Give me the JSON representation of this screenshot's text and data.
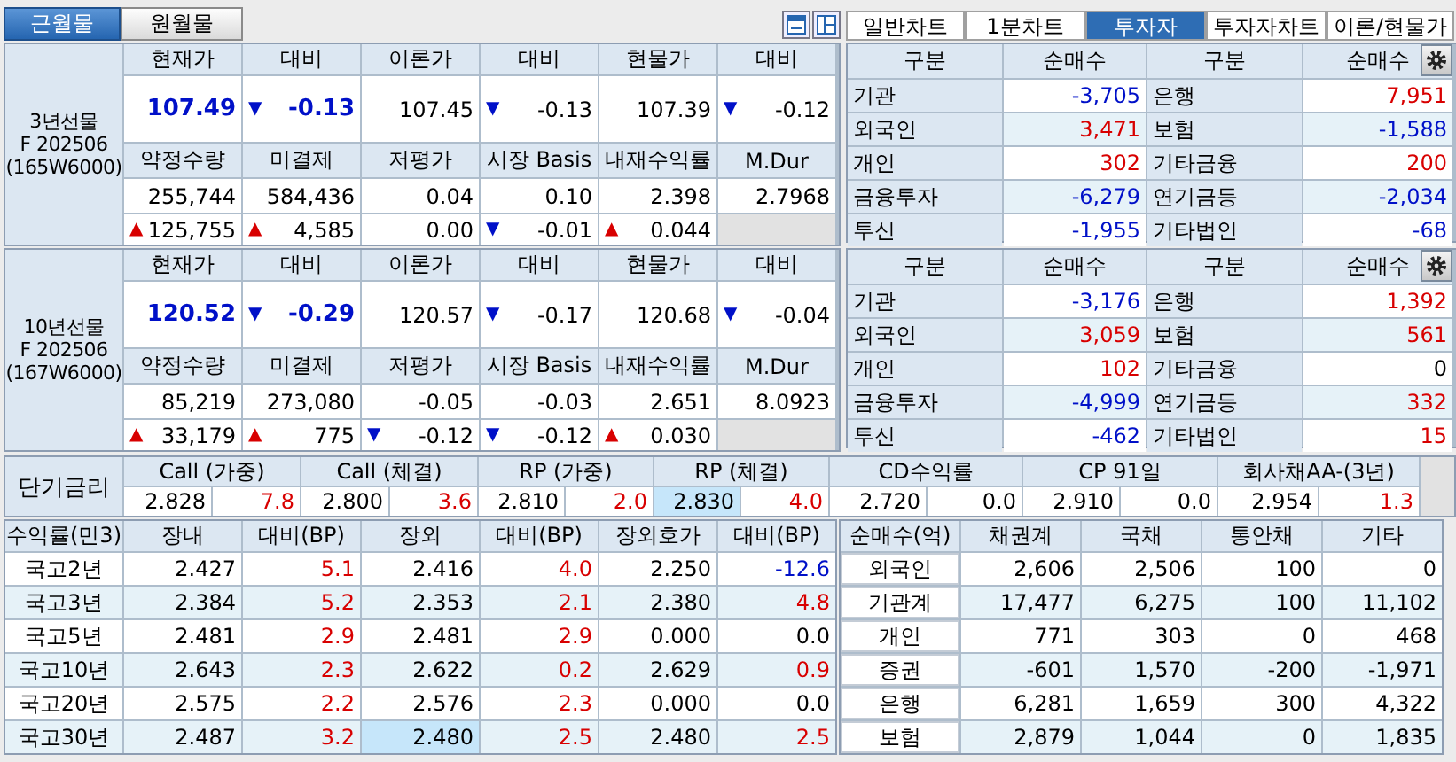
{
  "month_tabs": [
    {
      "label": "근월물",
      "selected": true
    },
    {
      "label": "원월물",
      "selected": false
    }
  ],
  "view_tabs": [
    {
      "label": "일반차트",
      "selected": false
    },
    {
      "label": "1분차트",
      "selected": false
    },
    {
      "label": "투자자",
      "selected": true
    },
    {
      "label": "투자자차트",
      "selected": false
    },
    {
      "label": "이론/현물가",
      "selected": false
    }
  ],
  "futures": [
    {
      "name": "3년선물",
      "contract": "F 202506",
      "code": "(165W6000)",
      "price_headers": [
        "현재가",
        "대비",
        "이론가",
        "대비",
        "현물가",
        "대비"
      ],
      "price_row": [
        {
          "value": "107.49",
          "emphasis": true
        },
        {
          "arrow": "▼",
          "rising": false,
          "value": "-0.13",
          "emphasis": true
        },
        {
          "value": "107.45",
          "emphasis": false
        },
        {
          "arrow": "▼",
          "rising": false,
          "value": "-0.13",
          "emphasis": false
        },
        {
          "value": "107.39",
          "emphasis": false
        },
        {
          "arrow": "▼",
          "rising": false,
          "value": "-0.12",
          "emphasis": false
        }
      ],
      "stat_headers": [
        "약정수량",
        "미결제",
        "저평가",
        "시장 Basis",
        "내재수익률",
        "M.Dur"
      ],
      "stat_row": [
        "255,744",
        "584,436",
        "0.04",
        "0.10",
        "2.398",
        "2.7968"
      ],
      "stat_change_row": [
        {
          "arrow": "▲",
          "rising": true,
          "value": "125,755"
        },
        {
          "arrow": "▲",
          "rising": true,
          "value": "4,585"
        },
        {
          "value": "0.00"
        },
        {
          "arrow": "▼",
          "rising": false,
          "value": "-0.01"
        },
        {
          "arrow": "▲",
          "rising": true,
          "value": "0.044"
        }
      ]
    },
    {
      "name": "10년선물",
      "contract": "F 202506",
      "code": "(167W6000)",
      "price_headers": [
        "현재가",
        "대비",
        "이론가",
        "대비",
        "현물가",
        "대비"
      ],
      "price_row": [
        {
          "value": "120.52",
          "emphasis": true
        },
        {
          "arrow": "▼",
          "rising": false,
          "value": "-0.29",
          "emphasis": true
        },
        {
          "value": "120.57",
          "emphasis": false
        },
        {
          "arrow": "▼",
          "rising": false,
          "value": "-0.17",
          "emphasis": false
        },
        {
          "value": "120.68",
          "emphasis": false
        },
        {
          "arrow": "▼",
          "rising": false,
          "value": "-0.04",
          "emphasis": false
        }
      ],
      "stat_headers": [
        "약정수량",
        "미결제",
        "저평가",
        "시장 Basis",
        "내재수익률",
        "M.Dur"
      ],
      "stat_row": [
        "85,219",
        "273,080",
        "-0.05",
        "-0.03",
        "2.651",
        "8.0923"
      ],
      "stat_change_row": [
        {
          "arrow": "▲",
          "rising": true,
          "value": "33,179"
        },
        {
          "arrow": "▲",
          "rising": true,
          "value": "775"
        },
        {
          "arrow": "▼",
          "rising": false,
          "value": "-0.12"
        },
        {
          "arrow": "▼",
          "rising": false,
          "value": "-0.12"
        },
        {
          "arrow": "▲",
          "rising": true,
          "value": "0.030"
        }
      ]
    }
  ],
  "investors": [
    {
      "headers": [
        "구분",
        "순매수",
        "구분",
        "순매수"
      ],
      "left": [
        {
          "name": "기관",
          "value": "-3,705",
          "rising": false,
          "falling": true
        },
        {
          "name": "외국인",
          "value": "3,471",
          "rising": true,
          "falling": false
        },
        {
          "name": "개인",
          "value": "302",
          "rising": true,
          "falling": false
        },
        {
          "name": "금융투자",
          "value": "-6,279",
          "rising": false,
          "falling": true
        },
        {
          "name": "투신",
          "value": "-1,955",
          "rising": false,
          "falling": true
        }
      ],
      "right": [
        {
          "name": "은행",
          "value": "7,951",
          "rising": true,
          "falling": false
        },
        {
          "name": "보험",
          "value": "-1,588",
          "rising": false,
          "falling": true
        },
        {
          "name": "기타금융",
          "value": "200",
          "rising": true,
          "falling": false
        },
        {
          "name": "연기금등",
          "value": "-2,034",
          "rising": false,
          "falling": true
        },
        {
          "name": "기타법인",
          "value": "-68",
          "rising": false,
          "falling": true
        }
      ]
    },
    {
      "headers": [
        "구분",
        "순매수",
        "구분",
        "순매수"
      ],
      "left": [
        {
          "name": "기관",
          "value": "-3,176",
          "rising": false,
          "falling": true
        },
        {
          "name": "외국인",
          "value": "3,059",
          "rising": true,
          "falling": false
        },
        {
          "name": "개인",
          "value": "102",
          "rising": true,
          "falling": false
        },
        {
          "name": "금융투자",
          "value": "-4,999",
          "rising": false,
          "falling": true
        },
        {
          "name": "투신",
          "value": "-462",
          "rising": false,
          "falling": true
        }
      ],
      "right": [
        {
          "name": "은행",
          "value": "1,392",
          "rising": true,
          "falling": false
        },
        {
          "name": "보험",
          "value": "561",
          "rising": true,
          "falling": false
        },
        {
          "name": "기타금융",
          "value": "0",
          "rising": false,
          "falling": false
        },
        {
          "name": "연기금등",
          "value": "332",
          "rising": true,
          "falling": false
        },
        {
          "name": "기타법인",
          "value": "15",
          "rising": true,
          "falling": false
        }
      ]
    }
  ],
  "short_rates": {
    "title": "단기금리",
    "items": [
      {
        "label": "Call (가중)",
        "rate": "2.828",
        "change": "7.8",
        "rising": true,
        "highlighted": false
      },
      {
        "label": "Call (체결)",
        "rate": "2.800",
        "change": "3.6",
        "rising": true,
        "highlighted": false
      },
      {
        "label": "RP (가중)",
        "rate": "2.810",
        "change": "2.0",
        "rising": true,
        "highlighted": false
      },
      {
        "label": "RP (체결)",
        "rate": "2.830",
        "change": "4.0",
        "rising": true,
        "highlighted": true
      },
      {
        "label": "CD수익률",
        "rate": "2.720",
        "change": "0.0",
        "rising": false,
        "highlighted": false
      },
      {
        "label": "CP 91일",
        "rate": "2.910",
        "change": "0.0",
        "rising": false,
        "highlighted": false
      },
      {
        "label": "회사채AA-(3년)",
        "rate": "2.954",
        "change": "1.3",
        "rising": true,
        "highlighted": false
      }
    ]
  },
  "yields": {
    "headers": [
      "수익률(민3)",
      "장내",
      "대비(BP)",
      "장외",
      "대비(BP)",
      "장외호가",
      "대비(BP)"
    ],
    "rows": [
      {
        "name": "국고2년",
        "cells": [
          {
            "value": "2.427",
            "rising": false,
            "falling": false,
            "highlighted": false
          },
          {
            "value": "5.1",
            "rising": true,
            "falling": false,
            "highlighted": false
          },
          {
            "value": "2.416",
            "rising": false,
            "falling": false,
            "highlighted": false
          },
          {
            "value": "4.0",
            "rising": true,
            "falling": false,
            "highlighted": false
          },
          {
            "value": "2.250",
            "rising": false,
            "falling": false,
            "highlighted": false
          },
          {
            "value": "-12.6",
            "rising": false,
            "falling": true,
            "highlighted": false
          }
        ]
      },
      {
        "name": "국고3년",
        "cells": [
          {
            "value": "2.384",
            "rising": false,
            "falling": false,
            "highlighted": false
          },
          {
            "value": "5.2",
            "rising": true,
            "falling": false,
            "highlighted": false
          },
          {
            "value": "2.353",
            "rising": false,
            "falling": false,
            "highlighted": false
          },
          {
            "value": "2.1",
            "rising": true,
            "falling": false,
            "highlighted": false
          },
          {
            "value": "2.380",
            "rising": false,
            "falling": false,
            "highlighted": false
          },
          {
            "value": "4.8",
            "rising": true,
            "falling": false,
            "highlighted": false
          }
        ]
      },
      {
        "name": "국고5년",
        "cells": [
          {
            "value": "2.481",
            "rising": false,
            "falling": false,
            "highlighted": false
          },
          {
            "value": "2.9",
            "rising": true,
            "falling": false,
            "highlighted": false
          },
          {
            "value": "2.481",
            "rising": false,
            "falling": false,
            "highlighted": false
          },
          {
            "value": "2.9",
            "rising": true,
            "falling": false,
            "highlighted": false
          },
          {
            "value": "0.000",
            "rising": false,
            "falling": false,
            "highlighted": false
          },
          {
            "value": "0.0",
            "rising": false,
            "falling": false,
            "highlighted": false
          }
        ]
      },
      {
        "name": "국고10년",
        "cells": [
          {
            "value": "2.643",
            "rising": false,
            "falling": false,
            "highlighted": false
          },
          {
            "value": "2.3",
            "rising": true,
            "falling": false,
            "highlighted": false
          },
          {
            "value": "2.622",
            "rising": false,
            "falling": false,
            "highlighted": false
          },
          {
            "value": "0.2",
            "rising": true,
            "falling": false,
            "highlighted": false
          },
          {
            "value": "2.629",
            "rising": false,
            "falling": false,
            "highlighted": false
          },
          {
            "value": "0.9",
            "rising": true,
            "falling": false,
            "highlighted": false
          }
        ]
      },
      {
        "name": "국고20년",
        "cells": [
          {
            "value": "2.575",
            "rising": false,
            "falling": false,
            "highlighted": false
          },
          {
            "value": "2.2",
            "rising": true,
            "falling": false,
            "highlighted": false
          },
          {
            "value": "2.576",
            "rising": false,
            "falling": false,
            "highlighted": false
          },
          {
            "value": "2.3",
            "rising": true,
            "falling": false,
            "highlighted": false
          },
          {
            "value": "0.000",
            "rising": false,
            "falling": false,
            "highlighted": false
          },
          {
            "value": "0.0",
            "rising": false,
            "falling": false,
            "highlighted": false
          }
        ]
      },
      {
        "name": "국고30년",
        "cells": [
          {
            "value": "2.487",
            "rising": false,
            "falling": false,
            "highlighted": false
          },
          {
            "value": "3.2",
            "rising": true,
            "falling": false,
            "highlighted": false
          },
          {
            "value": "2.480",
            "rising": false,
            "falling": false,
            "highlighted": true
          },
          {
            "value": "2.5",
            "rising": true,
            "falling": false,
            "highlighted": false
          },
          {
            "value": "2.480",
            "rising": false,
            "falling": false,
            "highlighted": false
          },
          {
            "value": "2.5",
            "rising": true,
            "falling": false,
            "highlighted": false
          }
        ]
      }
    ]
  },
  "net_buying": {
    "headers": [
      "순매수(억)",
      "채권계",
      "국채",
      "통안채",
      "기타"
    ],
    "rows": [
      {
        "name": "외국인",
        "values": [
          "2,606",
          "2,506",
          "100",
          "0"
        ]
      },
      {
        "name": "기관계",
        "values": [
          "17,477",
          "6,275",
          "100",
          "11,102"
        ]
      },
      {
        "name": "개인",
        "values": [
          "771",
          "303",
          "0",
          "468"
        ]
      },
      {
        "name": "증권",
        "values": [
          "-601",
          "1,570",
          "-200",
          "-1,971"
        ]
      },
      {
        "name": "은행",
        "values": [
          "6,281",
          "1,659",
          "300",
          "4,322"
        ]
      },
      {
        "name": "보험",
        "values": [
          "2,879",
          "1,044",
          "0",
          "1,835"
        ]
      }
    ]
  }
}
